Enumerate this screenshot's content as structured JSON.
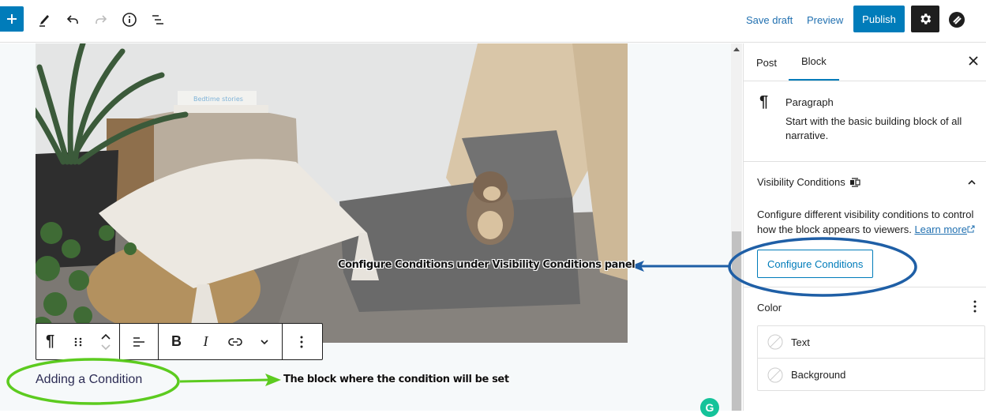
{
  "topbar": {
    "inserter_icon": "plus-icon",
    "tools_icon": "pencil-icon",
    "undo_icon": "undo-icon",
    "redo_icon": "redo-icon",
    "details_icon": "info-icon",
    "list_view_icon": "list-view-icon",
    "save_draft_label": "Save draft",
    "preview_label": "Preview",
    "publish_label": "Publish",
    "settings_icon": "gear-icon",
    "plugin_icon": "plugin-icon"
  },
  "editor": {
    "image_alt": "Kids play corner with cushions, poufs, plant and stuffed monkey",
    "book_text": "Bedtime stories",
    "paragraph_text": "Adding a Condition",
    "toolbar": {
      "paragraph_icon": "¶",
      "drag_icon": "drag-handle-icon",
      "move_up_icon": "chevron-up-icon",
      "move_down_icon": "chevron-down-icon",
      "align_icon": "align-left-icon",
      "bold_label": "B",
      "italic_label": "I",
      "link_icon": "link-icon",
      "more_rich_icon": "chevron-down-icon",
      "options_icon": "more-vertical-icon"
    }
  },
  "sidebar": {
    "tabs": [
      {
        "label": "Post",
        "active": false
      },
      {
        "label": "Block",
        "active": true
      }
    ],
    "close_icon": "close-icon",
    "block_card": {
      "icon": "¶",
      "title": "Paragraph",
      "description": "Start with the basic building block of all narrative."
    },
    "visibility_panel": {
      "title": "Visibility Conditions",
      "description": "Configure different visibility conditions to control how the block appears to viewers.",
      "learn_more": "Learn more",
      "button_label": "Configure Conditions",
      "expanded": true
    },
    "color_panel": {
      "title": "Color",
      "items": [
        {
          "label": "Text"
        },
        {
          "label": "Background"
        }
      ]
    }
  },
  "annotations": {
    "configure_note": "Configure Conditions under Visibility Conditions panel",
    "block_note": "The block where the condition will be set"
  },
  "colors": {
    "accent": "#007cba",
    "annotation_blue": "#1f5fa6",
    "annotation_green": "#5ccb1f",
    "grammarly": "#15c39a"
  }
}
